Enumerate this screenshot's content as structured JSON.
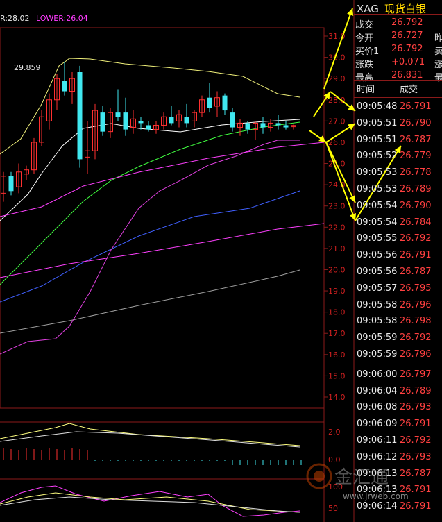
{
  "legend": {
    "upper": "R:28.02",
    "lower": "LOWER:26.04"
  },
  "header": {
    "code": "XAG",
    "name": "现货白银"
  },
  "quote": [
    {
      "label": "成交",
      "value": "26.792",
      "cut": ""
    },
    {
      "label": "今开",
      "value": "26.727",
      "cut": "昨"
    },
    {
      "label": "买价1",
      "value": "26.792",
      "cut": "卖"
    },
    {
      "label": "涨跌",
      "value": "+0.071",
      "cut": "涨"
    },
    {
      "label": "最高",
      "value": "26.831",
      "cut": "最"
    }
  ],
  "ticks_header": {
    "time": "时间",
    "price": "成交"
  },
  "ticks": [
    {
      "time": "09:05:48",
      "price": "26.791"
    },
    {
      "time": "09:05:51",
      "price": "26.790"
    },
    {
      "time": "09:05:51",
      "price": "26.787"
    },
    {
      "time": "09:05:52",
      "price": "26.779"
    },
    {
      "time": "09:05:53",
      "price": "26.778"
    },
    {
      "time": "09:05:53",
      "price": "26.789"
    },
    {
      "time": "09:05:54",
      "price": "26.790"
    },
    {
      "time": "09:05:54",
      "price": "26.784"
    },
    {
      "time": "09:05:55",
      "price": "26.792"
    },
    {
      "time": "09:05:56",
      "price": "26.791"
    },
    {
      "time": "09:05:56",
      "price": "26.787"
    },
    {
      "time": "09:05:57",
      "price": "26.795"
    },
    {
      "time": "09:05:58",
      "price": "26.796"
    },
    {
      "time": "09:05:58",
      "price": "26.798"
    },
    {
      "time": "09:05:59",
      "price": "26.792"
    },
    {
      "time": "09:05:59",
      "price": "26.796"
    },
    {
      "time": "09:06:00",
      "price": "26.797"
    },
    {
      "time": "09:06:04",
      "price": "26.789"
    },
    {
      "time": "09:06:08",
      "price": "26.793"
    },
    {
      "time": "09:06:09",
      "price": "26.791"
    },
    {
      "time": "09:06:11",
      "price": "26.792"
    },
    {
      "time": "09:06:12",
      "price": "26.793"
    },
    {
      "time": "09:06:13",
      "price": "26.787"
    },
    {
      "time": "09:06:13",
      "price": "26.791"
    },
    {
      "time": "09:06:14",
      "price": "26.791"
    }
  ],
  "price_axis": [
    "31.0",
    "30.0",
    "29.0",
    "28.0",
    "27.0",
    "26.0",
    "25.0",
    "24.0",
    "23.0",
    "22.0",
    "21.0",
    "20.0",
    "19.0",
    "18.0",
    "17.0",
    "16.0",
    "15.0",
    "14.0"
  ],
  "macd_axis": [
    "2.0",
    "0.0"
  ],
  "kdj_axis": [
    "100",
    "50"
  ],
  "high_label": "29.859",
  "watermark": {
    "brand": "金汇通",
    "site": "www.jrweb.com"
  },
  "colors": {
    "up": "#ff3030",
    "down": "#40e8f0",
    "grid": "#8b1a1a",
    "text_red": "#ff4040",
    "header_gold": "#ffd700",
    "arrow": "#ffff00"
  },
  "chart_data": [
    {
      "type": "candlestick",
      "ylim": [
        14.0,
        31.0
      ],
      "candles": [
        {
          "o": 23.6,
          "h": 24.6,
          "l": 23.2,
          "c": 24.4,
          "dir": "up"
        },
        {
          "o": 24.4,
          "h": 24.6,
          "l": 23.5,
          "c": 23.7,
          "dir": "down"
        },
        {
          "o": 23.9,
          "h": 25.0,
          "l": 23.6,
          "c": 24.6,
          "dir": "up"
        },
        {
          "o": 24.5,
          "h": 24.9,
          "l": 24.2,
          "c": 24.7,
          "dir": "up"
        },
        {
          "o": 24.7,
          "h": 26.2,
          "l": 24.5,
          "c": 26.0,
          "dir": "up"
        },
        {
          "o": 26.0,
          "h": 27.5,
          "l": 25.8,
          "c": 27.2,
          "dir": "up"
        },
        {
          "o": 27.0,
          "h": 28.3,
          "l": 26.6,
          "c": 28.0,
          "dir": "up"
        },
        {
          "o": 28.0,
          "h": 29.2,
          "l": 27.5,
          "c": 29.0,
          "dir": "up"
        },
        {
          "o": 28.9,
          "h": 29.8,
          "l": 28.2,
          "c": 28.4,
          "dir": "down"
        },
        {
          "o": 28.4,
          "h": 29.3,
          "l": 27.8,
          "c": 29.0,
          "dir": "up"
        },
        {
          "o": 29.3,
          "h": 29.6,
          "l": 24.8,
          "c": 25.2,
          "dir": "down"
        },
        {
          "o": 25.3,
          "h": 27.0,
          "l": 24.5,
          "c": 25.6,
          "dir": "up"
        },
        {
          "o": 25.6,
          "h": 27.8,
          "l": 25.2,
          "c": 27.5,
          "dir": "up"
        },
        {
          "o": 27.4,
          "h": 27.7,
          "l": 26.3,
          "c": 26.5,
          "dir": "down"
        },
        {
          "o": 26.5,
          "h": 27.6,
          "l": 26.2,
          "c": 27.4,
          "dir": "up"
        },
        {
          "o": 27.4,
          "h": 28.5,
          "l": 27.0,
          "c": 27.2,
          "dir": "down"
        },
        {
          "o": 27.4,
          "h": 28.1,
          "l": 26.3,
          "c": 26.6,
          "dir": "down"
        },
        {
          "o": 26.7,
          "h": 27.5,
          "l": 26.4,
          "c": 27.1,
          "dir": "up"
        },
        {
          "o": 27.0,
          "h": 27.2,
          "l": 26.6,
          "c": 26.9,
          "dir": "down"
        },
        {
          "o": 26.8,
          "h": 27.0,
          "l": 26.5,
          "c": 26.6,
          "dir": "down"
        },
        {
          "o": 26.6,
          "h": 27.0,
          "l": 26.4,
          "c": 26.8,
          "dir": "up"
        },
        {
          "o": 26.8,
          "h": 27.4,
          "l": 26.6,
          "c": 27.2,
          "dir": "up"
        },
        {
          "o": 27.2,
          "h": 27.7,
          "l": 26.8,
          "c": 26.9,
          "dir": "down"
        },
        {
          "o": 27.0,
          "h": 27.5,
          "l": 26.7,
          "c": 27.3,
          "dir": "up"
        },
        {
          "o": 27.2,
          "h": 27.8,
          "l": 26.7,
          "c": 26.9,
          "dir": "down"
        },
        {
          "o": 27.0,
          "h": 27.5,
          "l": 26.7,
          "c": 27.4,
          "dir": "up"
        },
        {
          "o": 27.4,
          "h": 28.2,
          "l": 27.2,
          "c": 28.0,
          "dir": "up"
        },
        {
          "o": 28.1,
          "h": 28.8,
          "l": 27.4,
          "c": 27.6,
          "dir": "down"
        },
        {
          "o": 27.7,
          "h": 28.4,
          "l": 27.2,
          "c": 28.1,
          "dir": "up"
        },
        {
          "o": 28.2,
          "h": 28.3,
          "l": 27.3,
          "c": 27.5,
          "dir": "down"
        },
        {
          "o": 27.4,
          "h": 27.6,
          "l": 26.5,
          "c": 26.7,
          "dir": "down"
        },
        {
          "o": 26.7,
          "h": 27.1,
          "l": 26.3,
          "c": 26.9,
          "dir": "up"
        },
        {
          "o": 26.9,
          "h": 27.0,
          "l": 26.4,
          "c": 26.6,
          "dir": "down"
        },
        {
          "o": 26.6,
          "h": 27.0,
          "l": 26.1,
          "c": 26.9,
          "dir": "up"
        },
        {
          "o": 26.9,
          "h": 27.2,
          "l": 26.4,
          "c": 26.7,
          "dir": "down"
        },
        {
          "o": 26.7,
          "h": 27.1,
          "l": 26.5,
          "c": 26.9,
          "dir": "up"
        },
        {
          "o": 26.9,
          "h": 27.3,
          "l": 26.6,
          "c": 26.8,
          "dir": "down"
        },
        {
          "o": 26.8,
          "h": 27.0,
          "l": 26.6,
          "c": 26.7,
          "dir": "down"
        },
        {
          "o": 26.73,
          "h": 26.83,
          "l": 26.6,
          "c": 26.79,
          "dir": "up"
        }
      ]
    }
  ]
}
